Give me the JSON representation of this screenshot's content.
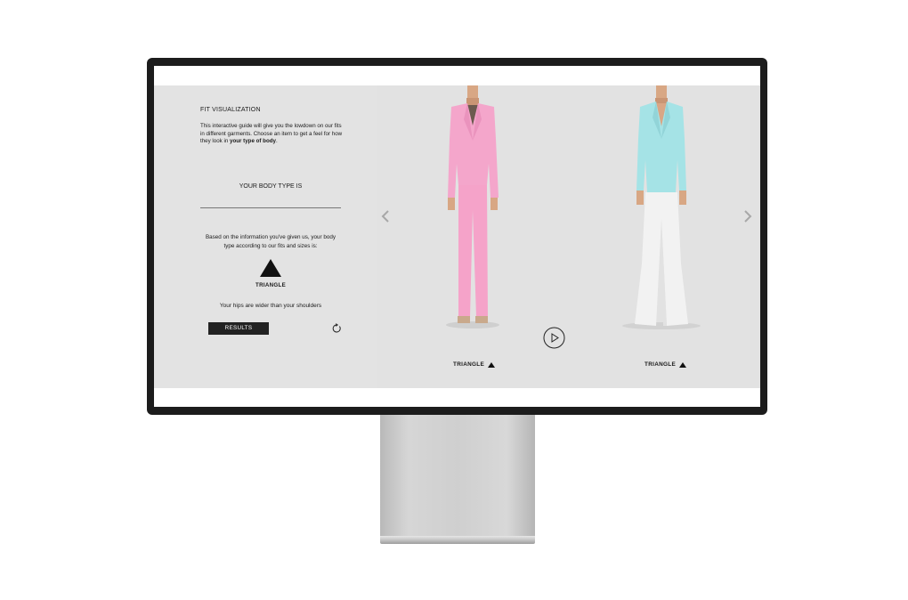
{
  "app": {
    "section_title": "FIT VISUALIZATION",
    "intro_text": "This interactive guide will give you the lowdown on our fits in different garments. Choose an item to get a feel for how they look in ",
    "intro_emphasis": "your type of body",
    "intro_end": ".",
    "body_type_label": "YOUR BODY TYPE IS",
    "body_type_value": "",
    "explanation": "Based on the information you've given us, your body type according to our fits and sizes is:",
    "result_shape_icon": "triangle-icon",
    "result_shape": "TRIANGLE",
    "result_description": "Your hips are wider than your shoulders",
    "results_button": "RESULTS",
    "reset_icon": "refresh-icon"
  },
  "gallery": {
    "prev_icon": "chevron-left-icon",
    "next_icon": "chevron-right-icon",
    "play_icon": "play-circle-icon",
    "items": [
      {
        "fit": "TRIANGLE",
        "blazer_color": "#f4a6cb",
        "trousers_color": "#f5a3c9"
      },
      {
        "fit": "TRIANGLE",
        "blazer_color": "#a5e3e6",
        "trousers_color": "#f2f2f2"
      }
    ]
  },
  "colors": {
    "panel_bg": "#e3e3e3",
    "button_bg": "#222222",
    "bezel": "#1c1c1c"
  }
}
